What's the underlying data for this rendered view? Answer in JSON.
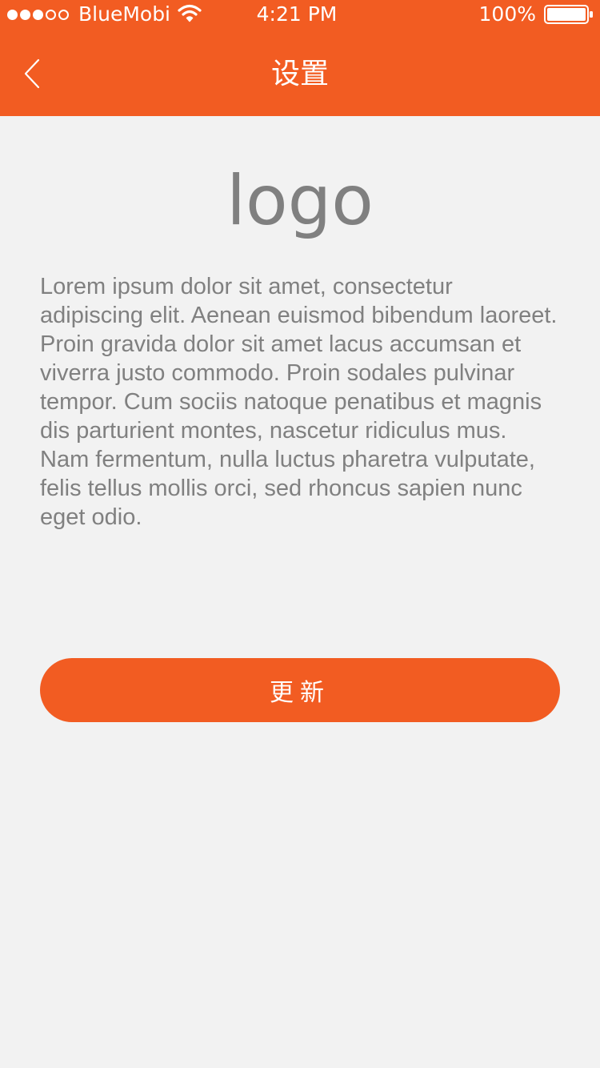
{
  "status_bar": {
    "carrier": "BlueMobi",
    "time": "4:21 PM",
    "battery_percent": "100%",
    "signal_bars_filled": 3,
    "signal_bars_total": 5,
    "battery_level": 1.0,
    "icons": [
      "signal-dots-icon",
      "wifi-icon",
      "battery-icon"
    ]
  },
  "nav": {
    "title": "设置",
    "back_icon": "chevron-left-icon"
  },
  "main": {
    "logo_text": "logo",
    "body_text": "Lorem ipsum dolor sit amet, consectetur adipiscing elit. Aenean euismod bibendum laoreet. Proin gravida dolor sit amet lacus accumsan et viverra justo commodo. Proin sodales pulvinar tempor. Cum sociis natoque penatibus et magnis dis parturient montes, nascetur ridiculus mus. Nam fermentum, nulla luctus pharetra vulputate, felis tellus mollis orci, sed rhoncus sapien nunc eget odio.",
    "update_button_label": "更新"
  },
  "colors": {
    "accent": "#f25c22",
    "background": "#f2f2f2",
    "text_gray": "#808080",
    "white": "#ffffff"
  }
}
